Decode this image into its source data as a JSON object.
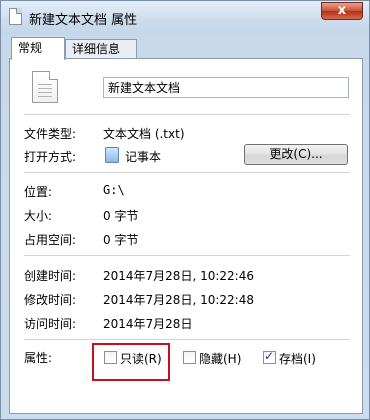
{
  "window": {
    "title": "新建文本文档 属性",
    "close_label": "x"
  },
  "tabs": [
    {
      "label": "常规",
      "active": true
    },
    {
      "label": "详细信息",
      "active": false
    }
  ],
  "general": {
    "file_name": "新建文本文档",
    "file_type_label": "文件类型:",
    "file_type_value": "文本文档 (.txt)",
    "opens_with_label": "打开方式:",
    "opens_with_value": "记事本",
    "change_button": "更改(C)...",
    "location_label": "位置:",
    "location_value": "G:\\",
    "size_label": "大小:",
    "size_value": "0 字节",
    "size_on_disk_label": "占用空间:",
    "size_on_disk_value": "0 字节",
    "created_label": "创建时间:",
    "created_value": "2014年7月28日, 10:22:46",
    "modified_label": "修改时间:",
    "modified_value": "2014年7月28日, 10:22:48",
    "accessed_label": "访问时间:",
    "accessed_value": "2014年7月28日",
    "attributes_label": "属性:",
    "attributes": [
      {
        "label": "只读(R)",
        "checked": false
      },
      {
        "label": "隐藏(H)",
        "checked": false
      },
      {
        "label": "存档(I)",
        "checked": true
      }
    ]
  },
  "colors": {
    "highlight": "#c4121b",
    "window_frame": "#c7d8ea"
  }
}
